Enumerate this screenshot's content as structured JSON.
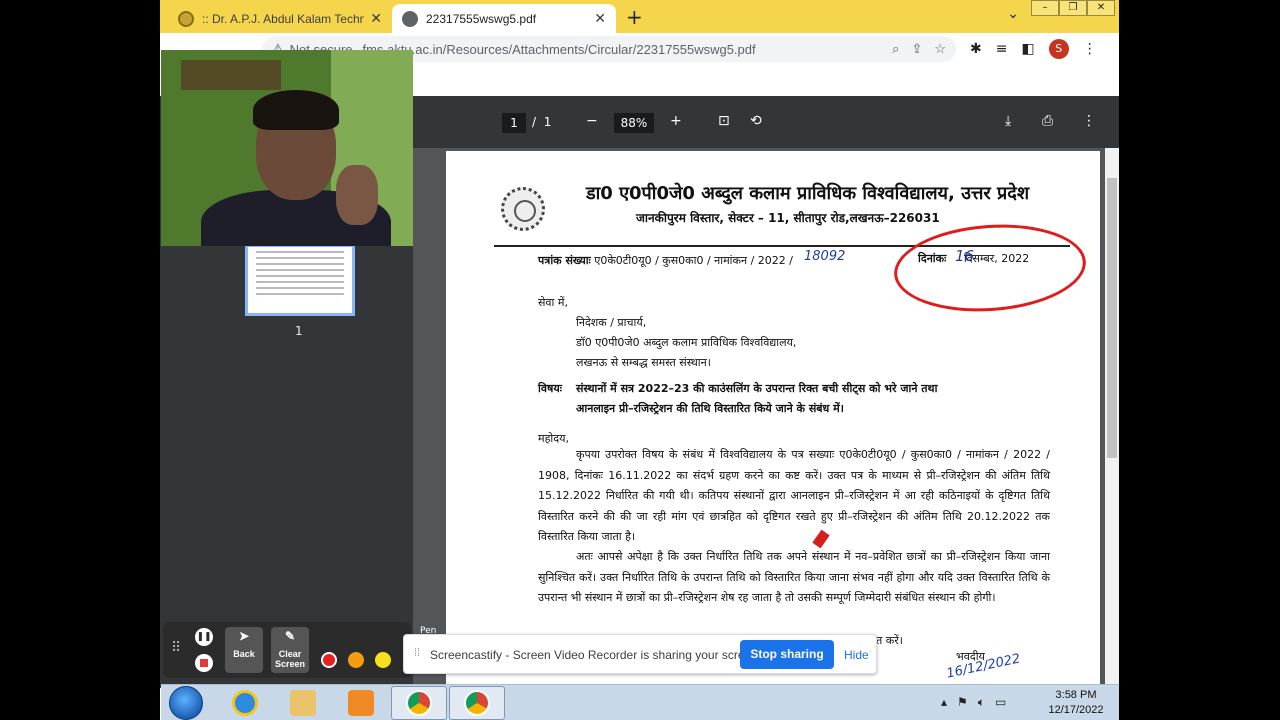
{
  "browser": {
    "tabs": [
      {
        "title": ":: Dr. A.P.J. Abdul Kalam Technica",
        "active": false
      },
      {
        "title": "22317555wswg5.pdf",
        "active": true
      }
    ],
    "new_tab_label": "+",
    "address": {
      "security_label": "Not secure",
      "url": "fms.aktu.ac.in/Resources/Attachments/Circular/22317555wswg5.pdf"
    },
    "profile_initial": "S"
  },
  "pdf_viewer": {
    "current_page": "1",
    "page_separator": "/",
    "total_pages": "1",
    "zoom": "88%",
    "thumbnail_number": "1"
  },
  "letter": {
    "university_name": "डा0 ए0पी0जे0 अब्दुल कलाम प्राविधिक विश्वविद्यालय, उत्तर प्रदेश",
    "address": "जानकीपुरम विस्तार, सेक्टर – 11, सीतापुर रोड,लखनऊ–226031",
    "ref_label": "पत्रांक संख्याः",
    "ref_value": "ए0के0टी0यू0 / कुस0का0 / नामांकन / 2022 /",
    "ref_handwritten": "18092",
    "date_label": "दिनांकः",
    "date_handwritten": "16",
    "date_value": "दिसम्बर, 2022",
    "to_label": "सेवा में,",
    "recipient_lines": [
      "निदेशक / प्राचार्य,",
      "डॉ0 ए0पी0जे0 अब्दुल कलाम प्राविधिक विश्वविद्यालय,",
      "लखनऊ से सम्बद्ध समस्त संस्थान।"
    ],
    "subject_label": "विषयः",
    "subject_line1": "संस्थानों में सत्र 2022–23 की काउंसलिंग के उपरान्त रिक्त बची सीट्स को भरे जाने तथा",
    "subject_line2": "आनलाइन प्री–रजिस्ट्रेशन की तिथि विस्तारित किये जाने के संबंध में।",
    "salutation": "महोदय,",
    "para1": "कृपया उपरोक्त विषय के संबंध में विश्वविद्यालय के पत्र सख्याः ए0के0टी0यू0 / कुस0का0 / नामांकन / 2022 / 1908, दिनांकः 16.11.2022 का संदर्भ ग्रहण करने का कष्ट करें। उक्त पत्र के माध्यम से प्री–रजिस्ट्रेशन की अंतिम तिथि 15.12.2022 निर्धारित की गयी थी। कतिपय संस्थानों द्वारा आनलाइन प्री–रजिस्ट्रेशन में आ रही कठिनाइयों के दृष्टिगत तिथि विस्तारित करने की की जा रही मांग एवं छात्रहित को दृष्टिगत रखते हुए प्री–रजिस्ट्रेशन की अंतिम तिथि 20.12.2022 तक विस्तारित किया जाता है।",
    "para2": "अतः आपसे अपेक्षा है कि उक्त निर्धारित तिथि तक अपने संस्थान में नव–प्रवेशित छात्रों का प्री–रजिस्ट्रेशन किया जाना सुनिश्चित करें। उक्त निर्धारित तिथि के उपरान्त तिथि को विस्तारित किया जाना संभव नहीं होगा और यदि उक्त विस्तारित तिथि के उपरान्त भी संस्थान में छात्रों का प्री–रजिस्ट्रेशन शेष रह जाता है तो उसकी सम्पूर्ण जिम्मेदारी संबंधित संस्थान की होगी।",
    "para3_tail": "त करें।",
    "closing": "भवदीय",
    "signature_scribble": "16/12/2022"
  },
  "screencastify": {
    "back_label": "Back",
    "clear_label": "Clear Screen",
    "pen_label": "Pen",
    "colors": [
      "#e82020",
      "#f39c12",
      "#f4e11c"
    ],
    "share_message": "Screencastify - Screen Video Recorder is sharing your screen.",
    "stop_sharing_label": "Stop sharing",
    "hide_label": "Hide"
  },
  "taskbar": {
    "time": "3:58 PM",
    "date": "12/17/2022"
  }
}
